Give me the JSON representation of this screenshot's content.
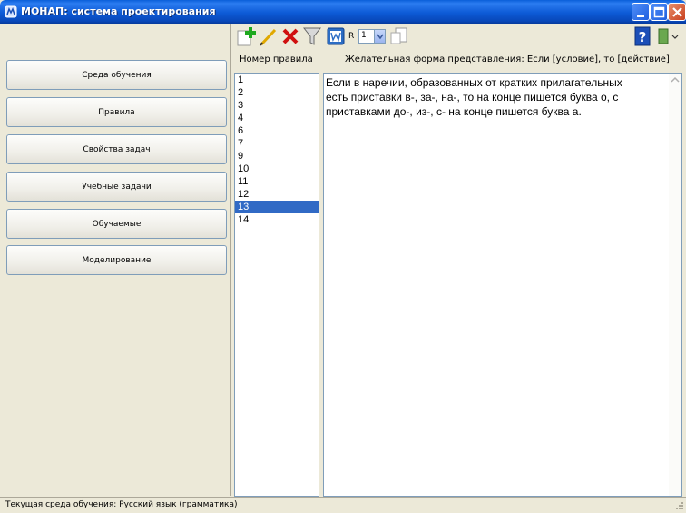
{
  "window": {
    "title": "МОНАП: система проектирования",
    "icon": "app-icon"
  },
  "nav": {
    "items": [
      {
        "label": "Среда обучения"
      },
      {
        "label": "Правила"
      },
      {
        "label": "Свойства задач"
      },
      {
        "label": "Учебные задачи"
      },
      {
        "label": "Обучаемые"
      },
      {
        "label": "Моделирование"
      }
    ]
  },
  "toolbar": {
    "r_label": "R",
    "r_value": "1",
    "icons": [
      "add-icon",
      "edit-pencil-icon",
      "delete-icon",
      "filter-funnel-icon",
      "word-icon",
      "copy-icon",
      "help-icon",
      "exit-door-icon"
    ]
  },
  "headers": {
    "rule_number": "Номер правила",
    "desired_form": "Желательная форма представления: Если [условие], то [действие]"
  },
  "rules": {
    "items": [
      "1",
      "2",
      "3",
      "4",
      "6",
      "7",
      "9",
      "10",
      "11",
      "12",
      "13",
      "14"
    ],
    "selected": "13"
  },
  "rule_text": {
    "line1": "Если в наречии, образованных от кратких прилагательных",
    "line2": "есть приставки в-, за-, на-, то на конце пишется буква о, с",
    "line3": "приставками до-, из-, с- на конце пишется буква а."
  },
  "status": {
    "text": "Текущая среда обучения:  Русский язык (грамматика)"
  },
  "colors": {
    "titlebar": "#0a5fd9",
    "selection": "#316ac5",
    "face": "#ece9d8"
  }
}
